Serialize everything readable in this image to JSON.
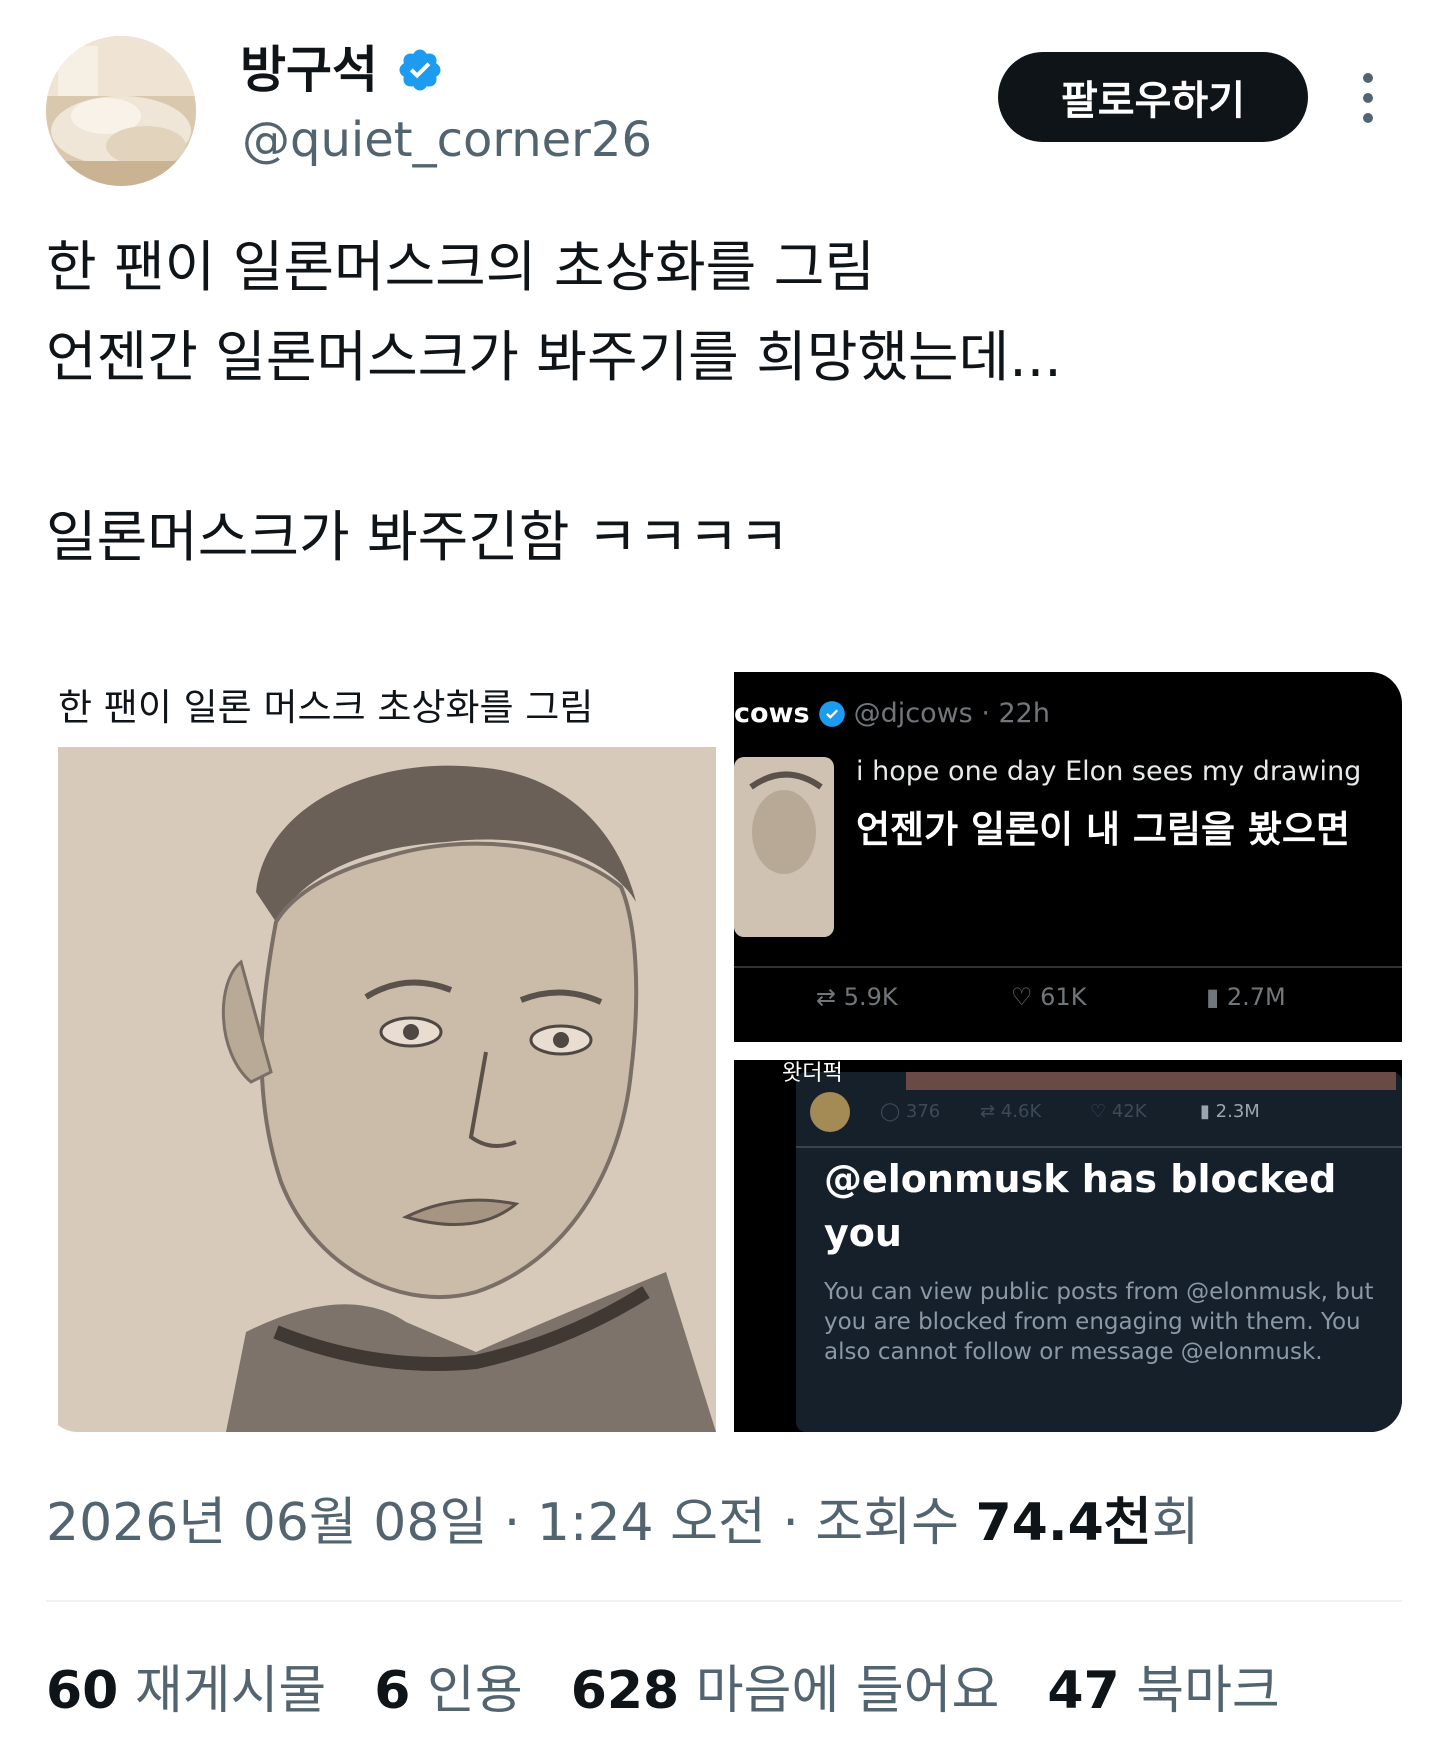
{
  "author": {
    "name": "방구석",
    "handle": "@quiet_corner26",
    "verified": true
  },
  "actions": {
    "follow_label": "팔로우하기",
    "more_icon": "more-vertical-icon"
  },
  "post": {
    "text": "한 팬이 일론머스크의 초상화를 그림\n언젠간 일론머스크가 봐주기를 희망했는데...\n\n일론머스크가 봐주긴함 ㅋㅋㅋㅋ"
  },
  "media": {
    "left_caption": "한 팬이 일론 머스크 초상화를 그림",
    "embedded_tweet": {
      "user": "cows",
      "handle_time": "@djcows · 22h",
      "text_en": "i hope one day Elon sees my drawing",
      "text_ko": "언젠가 일론이 내 그림을 봤으면",
      "retweets": "5.9K",
      "likes": "61K",
      "views": "2.7M"
    },
    "blocked_panel": {
      "watermark": "왓더퍽",
      "reply_count": "376",
      "repost_count": "4.6K",
      "like_count": "42K",
      "view_count": "2.3M",
      "title": "@elonmusk has blocked you",
      "body": "You can view public posts from @elonmusk, but you are blocked from engaging with them. You also cannot follow or message @elonmusk."
    }
  },
  "meta": {
    "datetime": "2026년 06월 08일 · 1:24 오전 · 조회수 ",
    "views_value": "74.4천",
    "views_suffix": "회"
  },
  "stats": [
    {
      "value": "60",
      "label": "재게시물"
    },
    {
      "value": "6",
      "label": "인용"
    },
    {
      "value": "628",
      "label": "마음에 들어요"
    },
    {
      "value": "47",
      "label": "북마크"
    }
  ],
  "colors": {
    "verified_blue": "#1d9bf0",
    "text_primary": "#0f1419",
    "text_secondary": "#536471",
    "button_bg": "#0f1419"
  }
}
